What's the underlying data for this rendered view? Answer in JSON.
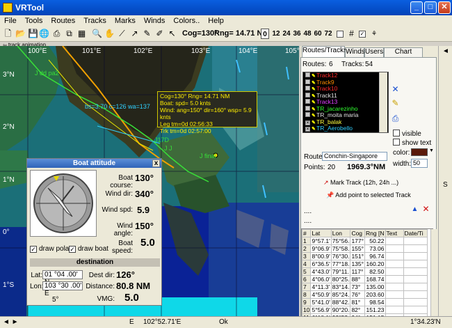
{
  "window": {
    "title": "VRTool",
    "min": "_",
    "max": "□",
    "close": "✕"
  },
  "menu": [
    "File",
    "Tools",
    "Routes",
    "Tracks",
    "Marks",
    "Winds",
    "Colors..",
    "Help"
  ],
  "toolbar": {
    "cog": "Cog=130°",
    "rng": "Rng= 14.71 N",
    "zoom_levels": [
      "0",
      "12",
      "24",
      "36",
      "48",
      "60",
      "72"
    ],
    "selected_zoom": "0"
  },
  "subtab": "track animation",
  "map": {
    "lon_labels": [
      "100°E",
      "101°E",
      "102°E",
      "103°E",
      "104°E",
      "105°E"
    ],
    "lat_labels": [
      "3°N",
      "2°N",
      "1°N",
      "0°",
      "1°S"
    ],
    "labels": {
      "bs": "bs=3.70 c=126 wa=137",
      "pp": "J dd pa2",
      "j17d": "J17D",
      "jj": "J J",
      "jfinal": "J final"
    },
    "info_box": [
      "Cog=130°  Rng= 14.71 NM",
      "Boat: spd= 5.0 knts",
      "Wind: ang=150° dir=160° wsp= 5.9 knts",
      "Leg tm=0d 02:56:33",
      "Trk tm=0d 02:57:00"
    ]
  },
  "attitude": {
    "title": "Boat attitude",
    "close": "x",
    "boat_course_label": "Boat course:",
    "boat_course": "130°",
    "wind_dir_label": "Wind dir:",
    "wind_dir": "340°",
    "wind_spd_label": "Wind spd:",
    "wind_spd": "5.9",
    "wind_angle_label": "Wind angle:",
    "wind_angle": "150°",
    "boat_speed_label": "Boat speed:",
    "boat_speed": "5.0",
    "draw_polar": "draw polar",
    "draw_boat": "draw boat",
    "destination": "destination",
    "lat_label": "Lat:",
    "lat": "01 °04 .00' N",
    "lon_label": "Lon:",
    "lon": "103 °30 .00' E",
    "dest_dir_label": "Dest dir:",
    "dest_dir": "126°",
    "distance_label": "Distance:",
    "distance": "80.8 NM",
    "vmg_label": "VMG:",
    "vmg": "5.0",
    "degree_note": "5°"
  },
  "panel": {
    "tabs": [
      "Routes/Tracks",
      "Winds",
      "Users",
      "Chart Images"
    ],
    "routes_label": "Routes:",
    "routes": "6",
    "tracks_label": "Tracks:",
    "tracks": "54",
    "track_items": [
      {
        "name": "Track12",
        "color": "#ff2a2a",
        "checked": false
      },
      {
        "name": "Track9",
        "color": "#ff8c00",
        "checked": false
      },
      {
        "name": "Track10",
        "color": "#ff2a2a",
        "checked": false
      },
      {
        "name": "Track11",
        "color": "#e0e0e0",
        "checked": false
      },
      {
        "name": "Track13",
        "color": "#e040ff",
        "checked": false
      },
      {
        "name": "TR_jacarezinho",
        "color": "#30ff30",
        "checked": false
      },
      {
        "name": "TR_moita maria",
        "color": "#e0e0e0",
        "checked": false
      },
      {
        "name": "TR_balak",
        "color": "#ffff40",
        "checked": true
      },
      {
        "name": "TR_Aerobello",
        "color": "#30d0ff",
        "checked": true
      }
    ],
    "visible": "visible",
    "show_text": "show text",
    "route_label": "Route:",
    "route": "Conchin-Singapore",
    "color_label": "color:",
    "points_label": "Points:",
    "points": "20",
    "distance": "1969.3°NM",
    "width_label": "width:",
    "width": "50",
    "mark_track": "Mark Track (12h, 24h ...)",
    "add_point": "Add point to selected Track",
    "dots1": "....",
    "dots2": "....",
    "grid_headers": [
      "#",
      "Lat",
      "Lon",
      "Cog",
      "Rng [N",
      "Text",
      "Date/Ti"
    ],
    "grid_rows": [
      [
        "1",
        "9°57.1'",
        "75°56.",
        "177°",
        "50.22"
      ],
      [
        "2",
        "9°06.9'",
        "75°58.",
        "155°",
        "73.06"
      ],
      [
        "3",
        "8°00.9'",
        "76°30.",
        "151°",
        "96.74"
      ],
      [
        "4",
        "6°36.5'",
        "77°18.",
        "135°",
        "160.20"
      ],
      [
        "5",
        "4°43.0'",
        "79°11.",
        "117°",
        "82.50"
      ],
      [
        "6",
        "4°06.0'",
        "80°25.",
        "88°",
        "168.74"
      ],
      [
        "7",
        "4°11.3'",
        "83°14.",
        "73°",
        "135.00"
      ],
      [
        "8",
        "4°50.9'",
        "85°24.",
        "76°",
        "203.60"
      ],
      [
        "9",
        "5°41.0'",
        "88°42.",
        "81°",
        "98.54"
      ],
      [
        "10",
        "5°56.9'",
        "90°20.",
        "82°",
        "151.23"
      ],
      [
        "11",
        "6°18.1'",
        "92°52.",
        "94°",
        "151.15"
      ]
    ]
  },
  "status": {
    "arrows": "◄ ►",
    "e_label": "E",
    "lon": "102°52.71'E",
    "ok": "Ok",
    "lat": "1°34.23'N"
  },
  "colors": {
    "sea": "#1b6f78",
    "land": "#2e7848",
    "deep": "#0b2a8a",
    "info_text": "#ffee00",
    "track_green": "#38e038",
    "track_orange": "#f0a000",
    "track_yellow": "#e8e800"
  }
}
